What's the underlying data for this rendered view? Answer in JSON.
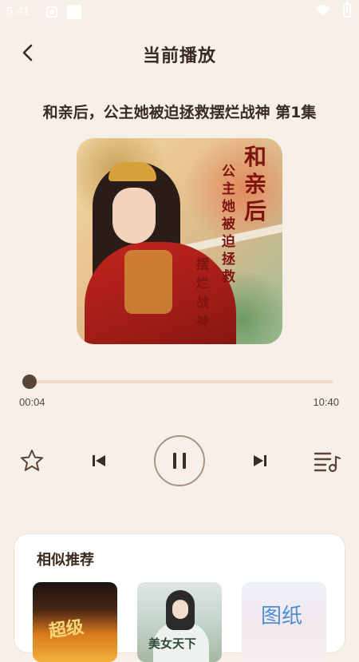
{
  "status_bar": {
    "time": "5:41"
  },
  "header": {
    "back_icon": "chevron-left-icon",
    "title": "当前播放"
  },
  "episode": {
    "title": "和亲后，公主她被迫拯救摆烂战神 第1集"
  },
  "cover": {
    "title_chars_right": [
      "和",
      "亲",
      "后"
    ],
    "title_chars_mid": [
      "公",
      "主",
      "她",
      "被",
      "迫",
      "拯",
      "救"
    ],
    "title_chars_left": [
      "摆",
      "烂",
      "战",
      "神"
    ]
  },
  "player": {
    "current_time": "00:04",
    "total_time": "10:40",
    "progress": 0.006
  },
  "controls": {
    "favorite_icon": "star-outline-icon",
    "prev_icon": "skip-previous-icon",
    "play_pause_icon": "pause-icon",
    "next_icon": "skip-next-icon",
    "playlist_icon": "playlist-music-icon"
  },
  "similar": {
    "title": "相似推荐",
    "items": [
      {
        "cover_text": "超级"
      },
      {
        "cover_text": "美女天下"
      },
      {
        "cover_text": "图纸"
      }
    ]
  },
  "colors": {
    "background": "#f7f0e8",
    "text": "#3a2c22",
    "accent": "#5a4638",
    "track": "#ecdccb"
  }
}
